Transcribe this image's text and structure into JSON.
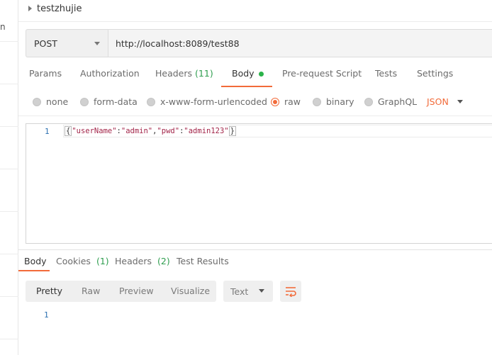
{
  "sidebar": {
    "stub_text": "n"
  },
  "collection": {
    "name": "testzhujie"
  },
  "request": {
    "method": "POST",
    "url": "http://localhost:8089/test88"
  },
  "request_tabs": [
    {
      "label": "Params"
    },
    {
      "label": "Authorization"
    },
    {
      "label": "Headers",
      "count": "(11)"
    },
    {
      "label": "Body",
      "active": true
    },
    {
      "label": "Pre-request Script"
    },
    {
      "label": "Tests"
    },
    {
      "label": "Settings"
    }
  ],
  "body_types": [
    {
      "label": "none"
    },
    {
      "label": "form-data"
    },
    {
      "label": "x-www-form-urlencoded"
    },
    {
      "label": "raw",
      "selected": true
    },
    {
      "label": "binary"
    },
    {
      "label": "GraphQL"
    }
  ],
  "body_format": "JSON",
  "editor": {
    "line_number": "1",
    "code": "{\"userName\":\"admin\",\"pwd\":\"admin123\"}",
    "tokens": {
      "open": "{",
      "key1": "\"userName\"",
      "colon": ":",
      "val1": "\"admin\"",
      "comma": ",",
      "key2": "\"pwd\"",
      "val2": "\"admin123\"",
      "close": "}"
    }
  },
  "response_tabs": [
    {
      "label": "Body",
      "active": true
    },
    {
      "label": "Cookies",
      "count": "(1)"
    },
    {
      "label": "Headers",
      "count": "(2)"
    },
    {
      "label": "Test Results"
    }
  ],
  "view_modes": [
    {
      "label": "Pretty",
      "active": true
    },
    {
      "label": "Raw"
    },
    {
      "label": "Preview"
    },
    {
      "label": "Visualize"
    }
  ],
  "response_format": "Text",
  "response_line_number": "1",
  "colors": {
    "accent": "#f26b3a",
    "count_green": "#2f9e4f",
    "status_dot": "#2bb34a",
    "json_string": "#a3264a",
    "line_number": "#2a6fb0"
  },
  "icons": {
    "wrap": "wrap-lines-icon",
    "collection_toggle": "caret-right-icon"
  }
}
